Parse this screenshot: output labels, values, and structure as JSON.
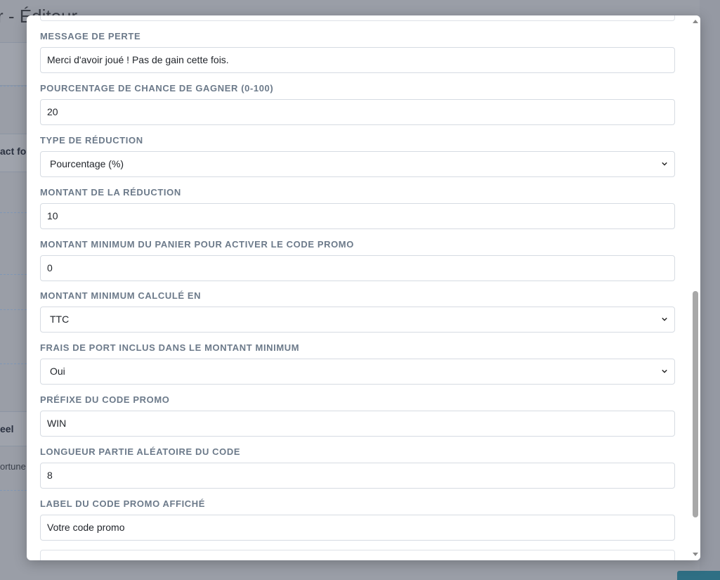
{
  "background": {
    "title": "r - Éditeur",
    "snippet_1": "act fo",
    "snippet_2": "eel",
    "snippet_3": "ortune"
  },
  "form": {
    "fields": [
      {
        "label": "MESSAGE DE PERTE",
        "value": "Merci d'avoir joué ! Pas de gain cette fois.",
        "type": "input"
      },
      {
        "label": "POURCENTAGE DE CHANCE DE GAGNER (0-100)",
        "value": "20",
        "type": "input"
      },
      {
        "label": "TYPE DE RÉDUCTION",
        "value": "Pourcentage (%)",
        "type": "select"
      },
      {
        "label": "MONTANT DE LA RÉDUCTION",
        "value": "10",
        "type": "input"
      },
      {
        "label": "MONTANT MINIMUM DU PANIER POUR ACTIVER LE CODE PROMO",
        "value": "0",
        "type": "input"
      },
      {
        "label": "MONTANT MINIMUM CALCULÉ EN",
        "value": "TTC",
        "type": "select"
      },
      {
        "label": "FRAIS DE PORT INCLUS DANS LE MONTANT MINIMUM",
        "value": "Oui",
        "type": "select"
      },
      {
        "label": "PRÉFIXE DU CODE PROMO",
        "value": "WIN",
        "type": "input"
      },
      {
        "label": "LONGUEUR PARTIE ALÉATOIRE DU CODE",
        "value": "8",
        "type": "input"
      },
      {
        "label": "LABEL DU CODE PROMO AFFICHÉ",
        "value": "Votre code promo",
        "type": "input"
      }
    ]
  },
  "icons": {
    "select_arrow": "chevron-down-icon",
    "scroll_up": "triangle-up-icon",
    "scroll_down": "triangle-down-icon"
  },
  "scroll": {
    "position_fraction": 0.51,
    "visible_fraction": 0.42
  },
  "colors": {
    "label": "#6c7a8a",
    "border": "#d6dbe2",
    "overlay": "#9a9ea7",
    "accent_button": "#2f6f84"
  }
}
